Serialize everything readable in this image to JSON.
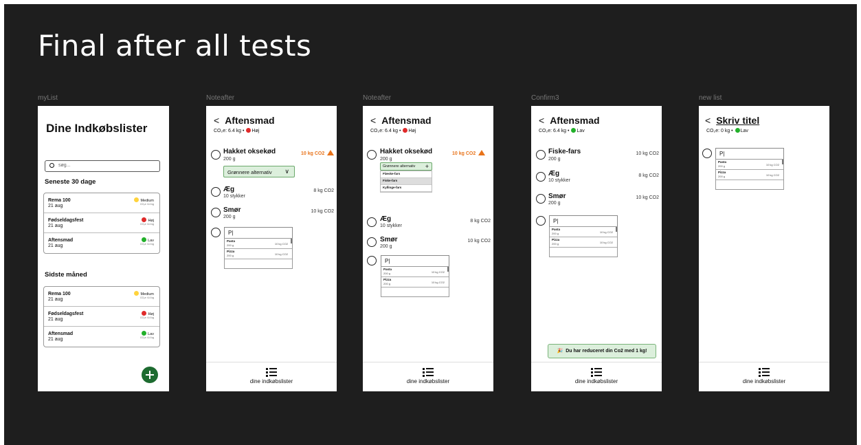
{
  "title": "Final after all tests",
  "colors": {
    "background": "#1e1e1e",
    "green": "#1d6b30",
    "yellow": "#ffd33d",
    "red": "#e02a2a",
    "leaf": "#22b02a",
    "orange": "#e8731a"
  },
  "nav_label": "dine indkøbslister",
  "frames": {
    "mylist": {
      "label": "myList",
      "heading": "Dine Indkøbslister",
      "search_placeholder": "søg...",
      "section1": "Seneste 30 dage",
      "section2": "Sidste måned",
      "lists": [
        {
          "name": "Rema 100",
          "date": "21 aug",
          "level": "Medium",
          "co2": "CO₂e: 6.4 kg"
        },
        {
          "name": "Fødseldagsfest",
          "date": "21 aug",
          "level": "Høj",
          "co2": "CO₂e: 6.4 kg"
        },
        {
          "name": "Aftensmad",
          "date": "21 aug",
          "level": "Lav",
          "co2": "CO₂e: 6.4 kg"
        }
      ],
      "add_icon": "plus-icon"
    },
    "noteafter1": {
      "label": "Noteafter",
      "title": "Aftensmad",
      "co2_text": "CO₂e: 6.4 kg",
      "level": "Høj",
      "items": [
        {
          "name": "Hakket oksekød",
          "qty": "200 g",
          "value": "10 kg CO2"
        },
        {
          "name": "Æg",
          "qty": "10 stykker",
          "value": "8 kg CO2"
        },
        {
          "name": "Smør",
          "qty": "200 g",
          "value": "10 kg CO2"
        }
      ],
      "alt_button": "Grønnere alternativ",
      "input_value": "P|",
      "suggestions": [
        {
          "name": "Pasta",
          "qty": "200 g",
          "value": "10 kg CO2"
        },
        {
          "name": "Pizza",
          "qty": "200 g",
          "value": "10 kg CO2"
        }
      ]
    },
    "noteafter2": {
      "label": "Noteafter",
      "title": "Aftensmad",
      "co2_text": "CO₂e: 6.4 kg",
      "level": "Høj",
      "items": [
        {
          "name": "Hakket oksekød",
          "qty": "200 g",
          "value": "10 kg CO2"
        },
        {
          "name": "Æg",
          "qty": "10 stykker",
          "value": "8 kg CO2"
        },
        {
          "name": "Smør",
          "qty": "200 g",
          "value": "10 kg CO2"
        }
      ],
      "alt_button": "Grønnere alternativ",
      "alternatives": [
        "Flæske-fars",
        "Fiske-fars",
        "Kyllinge-fars"
      ],
      "input_value": "P|",
      "suggestions": [
        {
          "name": "Pasta",
          "qty": "200 g",
          "value": "10 kg CO2"
        },
        {
          "name": "Pizza",
          "qty": "200 g",
          "value": "10 kg CO2"
        }
      ]
    },
    "confirm3": {
      "label": "Confirm3",
      "title": "Aftensmad",
      "co2_text": "CO₂e: 6.4 kg",
      "level": "Lav",
      "items": [
        {
          "name": "Fiske-fars",
          "qty": "200 g",
          "value": "10 kg CO2"
        },
        {
          "name": "Æg",
          "qty": "10 stykker",
          "value": "8 kg CO2"
        },
        {
          "name": "Smør",
          "qty": "200 g",
          "value": "10 kg CO2"
        }
      ],
      "input_value": "P|",
      "suggestions": [
        {
          "name": "Pasta",
          "qty": "200 g",
          "value": "10 kg CO2"
        },
        {
          "name": "Pizza",
          "qty": "200 g",
          "value": "10 kg CO2"
        }
      ],
      "toast": "Du har reduceret din Co2 med 1 kg!",
      "toast_icon": "party-popper-icon"
    },
    "newlist": {
      "label": "new list",
      "title": "Skriv titel",
      "co2_text": "CO₂e: 0 kg",
      "level": "Lav",
      "input_value": "P|",
      "suggestions": [
        {
          "name": "Pasta",
          "qty": "200 g",
          "value": "10 kg CO2"
        },
        {
          "name": "Pizza",
          "qty": "200 g",
          "value": "10 kg CO2"
        }
      ]
    }
  }
}
